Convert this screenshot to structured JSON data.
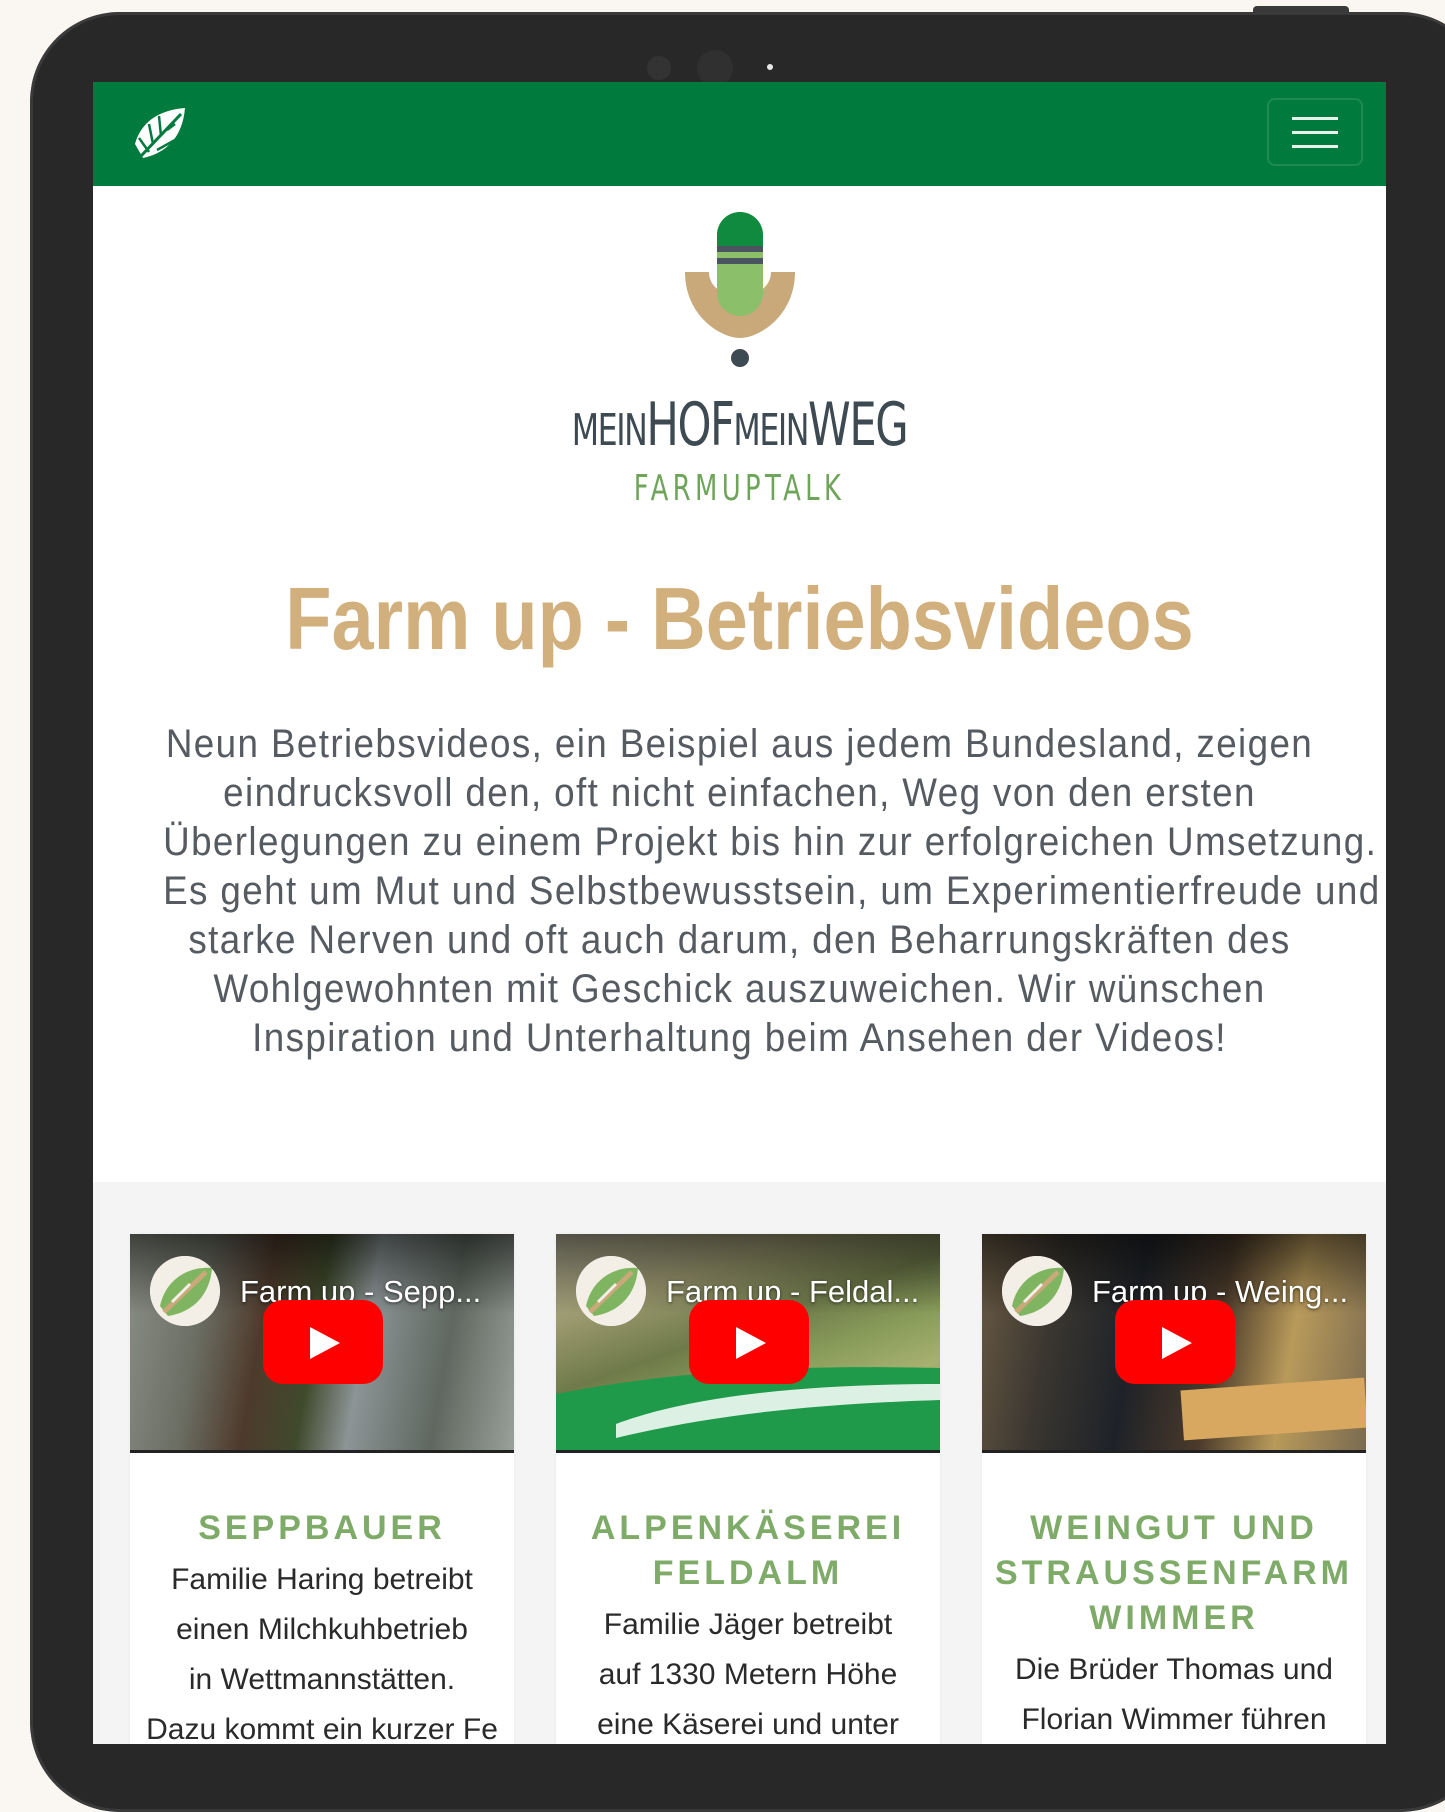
{
  "header": {
    "logo_icon": "leaf-logo-icon",
    "menu_icon": "hamburger-menu-icon"
  },
  "brand": {
    "mic_icon": "microphone-logo-icon",
    "name_part1": "MEIN",
    "name_part2": "HOF",
    "name_part3": "MEIN",
    "name_part4": "WEG",
    "subtitle": "FARMUPTALK"
  },
  "main": {
    "title": "Farm up - Betriebsvideos",
    "intro_lines": [
      "Neun Betriebsvideos, ein Beispiel aus jedem Bundesland, zeigen",
      "eindrucksvoll den, oft nicht einfachen, Weg von den ersten",
      "Überlegungen zu einem Projekt bis hin zur erfolgreichen Umsetzung.",
      "Es geht um Mut und Selbstbewusstsein, um Experimentierfreude und",
      "starke Nerven und oft auch darum, den Beharrungskräften des",
      "Wohlgewohnten mit Geschick auszuweichen. Wir wünschen",
      "Inspiration und Unterhaltung beim Ansehen der Videos!"
    ]
  },
  "cards": [
    {
      "video_title": "Farm up - Sepp...",
      "title_lines": [
        "SEPPBAUER"
      ],
      "text_lines": [
        "Familie Haring betreibt",
        "einen Milchkuhbetrieb",
        "in Wettmannstätten.",
        "Dazu kommt ein kurzer Fe"
      ]
    },
    {
      "video_title": "Farm up - Feldal...",
      "title_lines": [
        "ALPENKÄSEREI",
        "FELDALM"
      ],
      "text_lines": [
        "Familie Jäger betreibt",
        "auf 1330 Metern Höhe",
        "eine Käserei und unter"
      ]
    },
    {
      "video_title": "Farm up - Weing...",
      "title_lines": [
        "WEINGUT UND",
        "STRAUSSENFARM",
        "WIMMER"
      ],
      "text_lines": [
        "Die Brüder Thomas und",
        "Florian Wimmer führen"
      ]
    }
  ],
  "colors": {
    "nav_green": "#007a3d",
    "title_gold": "#d2b07e",
    "card_title_green": "#7fab68",
    "youtube_red": "#ff0000"
  }
}
